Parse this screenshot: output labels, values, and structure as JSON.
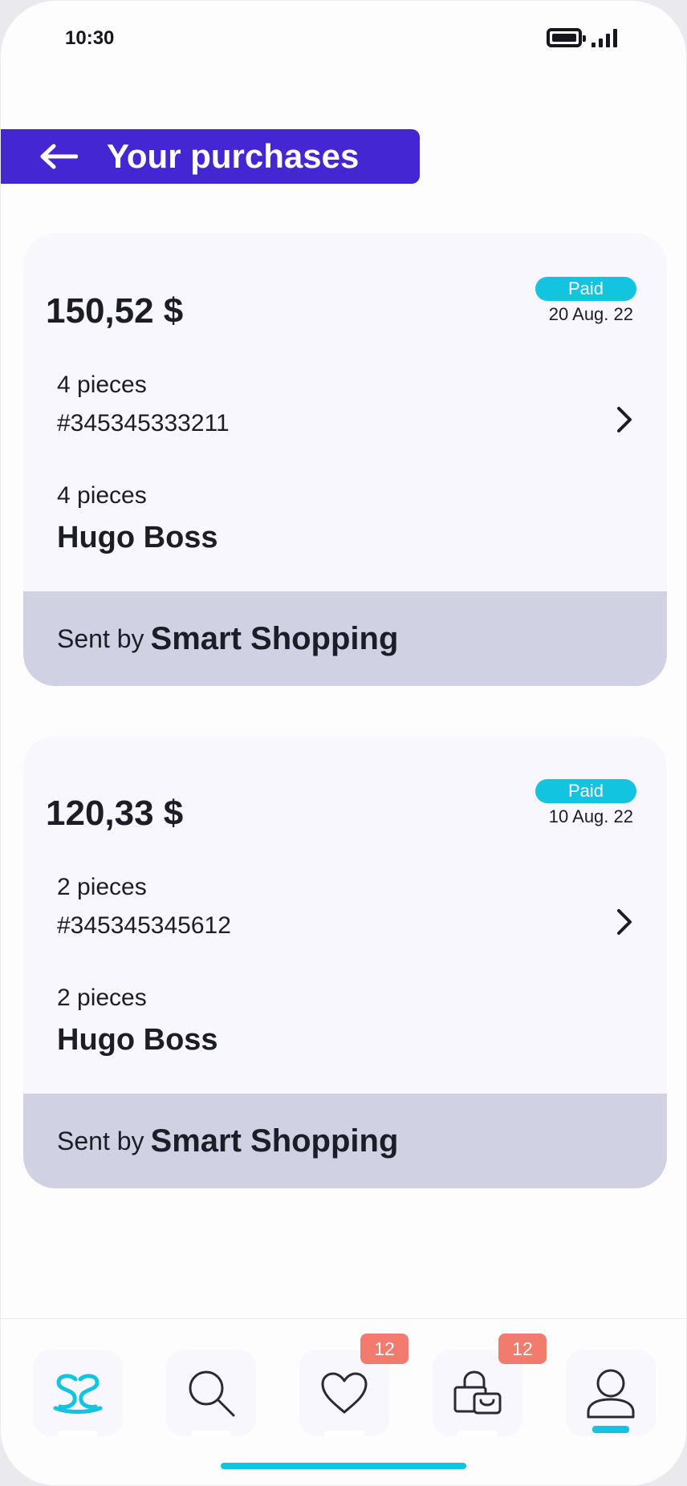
{
  "status_bar": {
    "time": "10:30"
  },
  "header": {
    "title": "Your purchases",
    "back_icon": "arrow-left-icon"
  },
  "orders": [
    {
      "amount": "150,52 $",
      "status": "Paid",
      "date": "20 Aug. 22",
      "pieces": "4 pieces",
      "order_number": "#345345333211",
      "brand_pieces": "4 pieces",
      "brand": "Hugo Boss",
      "sent_by_label": "Sent by",
      "sender": "Smart Shopping"
    },
    {
      "amount": "120,33 $",
      "status": "Paid",
      "date": "10 Aug. 22",
      "pieces": "2 pieces",
      "order_number": "#345345345612",
      "brand_pieces": "2 pieces",
      "brand": "Hugo Boss",
      "sent_by_label": "Sent by",
      "sender": "Smart Shopping"
    }
  ],
  "bottom_nav": {
    "items": [
      {
        "icon": "logo-icon",
        "active": false
      },
      {
        "icon": "search-icon",
        "active": false
      },
      {
        "icon": "heart-icon",
        "badge": "12",
        "active": false
      },
      {
        "icon": "shopping-bag-icon",
        "badge": "12",
        "active": false
      },
      {
        "icon": "profile-icon",
        "active": true
      }
    ]
  },
  "colors": {
    "accent": "#4427d3",
    "cyan": "#12c4e0",
    "badge": "#f17c6d",
    "card": "#f8f7fd",
    "card_footer": "#d0d2e4"
  }
}
